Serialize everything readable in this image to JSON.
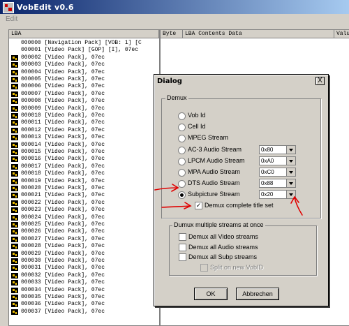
{
  "app": {
    "title": "VobEdit v0.6",
    "menu_edit": "Edit"
  },
  "left_pane": {
    "column_header": "LBA",
    "rows": [
      {
        "text": "000000 [Navigation Pack] [VOB: 1] [C",
        "icon": "none"
      },
      {
        "text": "000001 [Video Pack] [GOP] [I], 07ec",
        "icon": "none"
      },
      {
        "text": "000002 [Video Pack], 07ec",
        "icon": "video-pack-icon"
      },
      {
        "text": "000003 [Video Pack], 07ec",
        "icon": "video-pack-icon"
      },
      {
        "text": "000004 [Video Pack], 07ec",
        "icon": "video-pack-icon"
      },
      {
        "text": "000005 [Video Pack], 07ec",
        "icon": "video-pack-icon"
      },
      {
        "text": "000006 [Video Pack], 07ec",
        "icon": "video-pack-icon"
      },
      {
        "text": "000007 [Video Pack], 07ec",
        "icon": "video-pack-icon"
      },
      {
        "text": "000008 [Video Pack], 07ec",
        "icon": "video-pack-icon"
      },
      {
        "text": "000009 [Video Pack], 07ec",
        "icon": "video-pack-icon"
      },
      {
        "text": "000010 [Video Pack], 07ec",
        "icon": "video-pack-icon"
      },
      {
        "text": "000011 [Video Pack], 07ec",
        "icon": "video-pack-icon"
      },
      {
        "text": "000012 [Video Pack], 07ec",
        "icon": "video-pack-icon"
      },
      {
        "text": "000013 [Video Pack], 07ec",
        "icon": "video-pack-icon"
      },
      {
        "text": "000014 [Video Pack], 07ec",
        "icon": "video-pack-icon"
      },
      {
        "text": "000015 [Video Pack], 07ec",
        "icon": "video-pack-icon"
      },
      {
        "text": "000016 [Video Pack], 07ec",
        "icon": "video-pack-icon"
      },
      {
        "text": "000017 [Video Pack], 07ec",
        "icon": "video-pack-icon"
      },
      {
        "text": "000018 [Video Pack], 07ec",
        "icon": "video-pack-icon"
      },
      {
        "text": "000019 [Video Pack], 07ec",
        "icon": "video-pack-icon"
      },
      {
        "text": "000020 [Video Pack], 07ec",
        "icon": "video-pack-icon"
      },
      {
        "text": "000021 [Video Pack], 07ec",
        "icon": "video-pack-icon"
      },
      {
        "text": "000022 [Video Pack], 07ec",
        "icon": "video-pack-icon"
      },
      {
        "text": "000023 [Video Pack], 07ec",
        "icon": "video-pack-icon"
      },
      {
        "text": "000024 [Video Pack], 07ec",
        "icon": "video-pack-icon"
      },
      {
        "text": "000025 [Video Pack], 07ec",
        "icon": "video-pack-icon"
      },
      {
        "text": "000026 [Video Pack], 07ec",
        "icon": "video-pack-icon"
      },
      {
        "text": "000027 [Video Pack], 07ec",
        "icon": "video-pack-icon"
      },
      {
        "text": "000028 [Video Pack], 07ec",
        "icon": "video-pack-icon"
      },
      {
        "text": "000029 [Video Pack], 07ec",
        "icon": "video-pack-icon"
      },
      {
        "text": "000030 [Video Pack], 07ec",
        "icon": "video-pack-icon"
      },
      {
        "text": "000031 [Video Pack], 07ec",
        "icon": "video-pack-icon"
      },
      {
        "text": "000032 [Video Pack], 07ec",
        "icon": "video-pack-icon"
      },
      {
        "text": "000033 [Video Pack], 07ec",
        "icon": "video-pack-icon"
      },
      {
        "text": "000034 [Video Pack], 07ec",
        "icon": "video-pack-icon"
      },
      {
        "text": "000035 [Video Pack], 07ec",
        "icon": "video-pack-icon"
      },
      {
        "text": "000036 [Video Pack], 07ec",
        "icon": "video-pack-icon"
      },
      {
        "text": "000037 [Video Pack], 07ec",
        "icon": "video-pack-icon"
      }
    ]
  },
  "right_pane": {
    "col_byte": "Byte",
    "col_contents": "LBA Contents Data",
    "col_value": "Valu"
  },
  "dialog": {
    "title": "Dialog",
    "close_label": "X",
    "demux_group": "Demux",
    "options": [
      {
        "label": "Vob Id",
        "selected": false,
        "combo": null
      },
      {
        "label": "Cell Id",
        "selected": false,
        "combo": null
      },
      {
        "label": "MPEG Stream",
        "selected": false,
        "combo": null
      },
      {
        "label": "AC-3 Audio Stream",
        "selected": false,
        "combo": "0x80"
      },
      {
        "label": "LPCM Audio Stream",
        "selected": false,
        "combo": "0xA0"
      },
      {
        "label": "MPA Audio Stream",
        "selected": false,
        "combo": "0xC0"
      },
      {
        "label": "DTS Audio Stream",
        "selected": false,
        "combo": "0x88"
      },
      {
        "label": "Subpicture Stream",
        "selected": true,
        "combo": "0x20"
      }
    ],
    "demux_complete": {
      "label": "Demux complete title set",
      "checked": true
    },
    "multi_group": "Dumux multiple streams at once",
    "multi": [
      {
        "label": "Demux all Video streams",
        "checked": false,
        "disabled": false
      },
      {
        "label": "Demux all Audio streams",
        "checked": false,
        "disabled": false
      },
      {
        "label": "Demux all Subp streams",
        "checked": false,
        "disabled": false
      },
      {
        "label": "Split on new VobID",
        "checked": false,
        "disabled": true
      }
    ],
    "ok_label": "OK",
    "cancel_label": "Abbrechen"
  },
  "colors": {
    "annotation_red": "#e00000"
  }
}
